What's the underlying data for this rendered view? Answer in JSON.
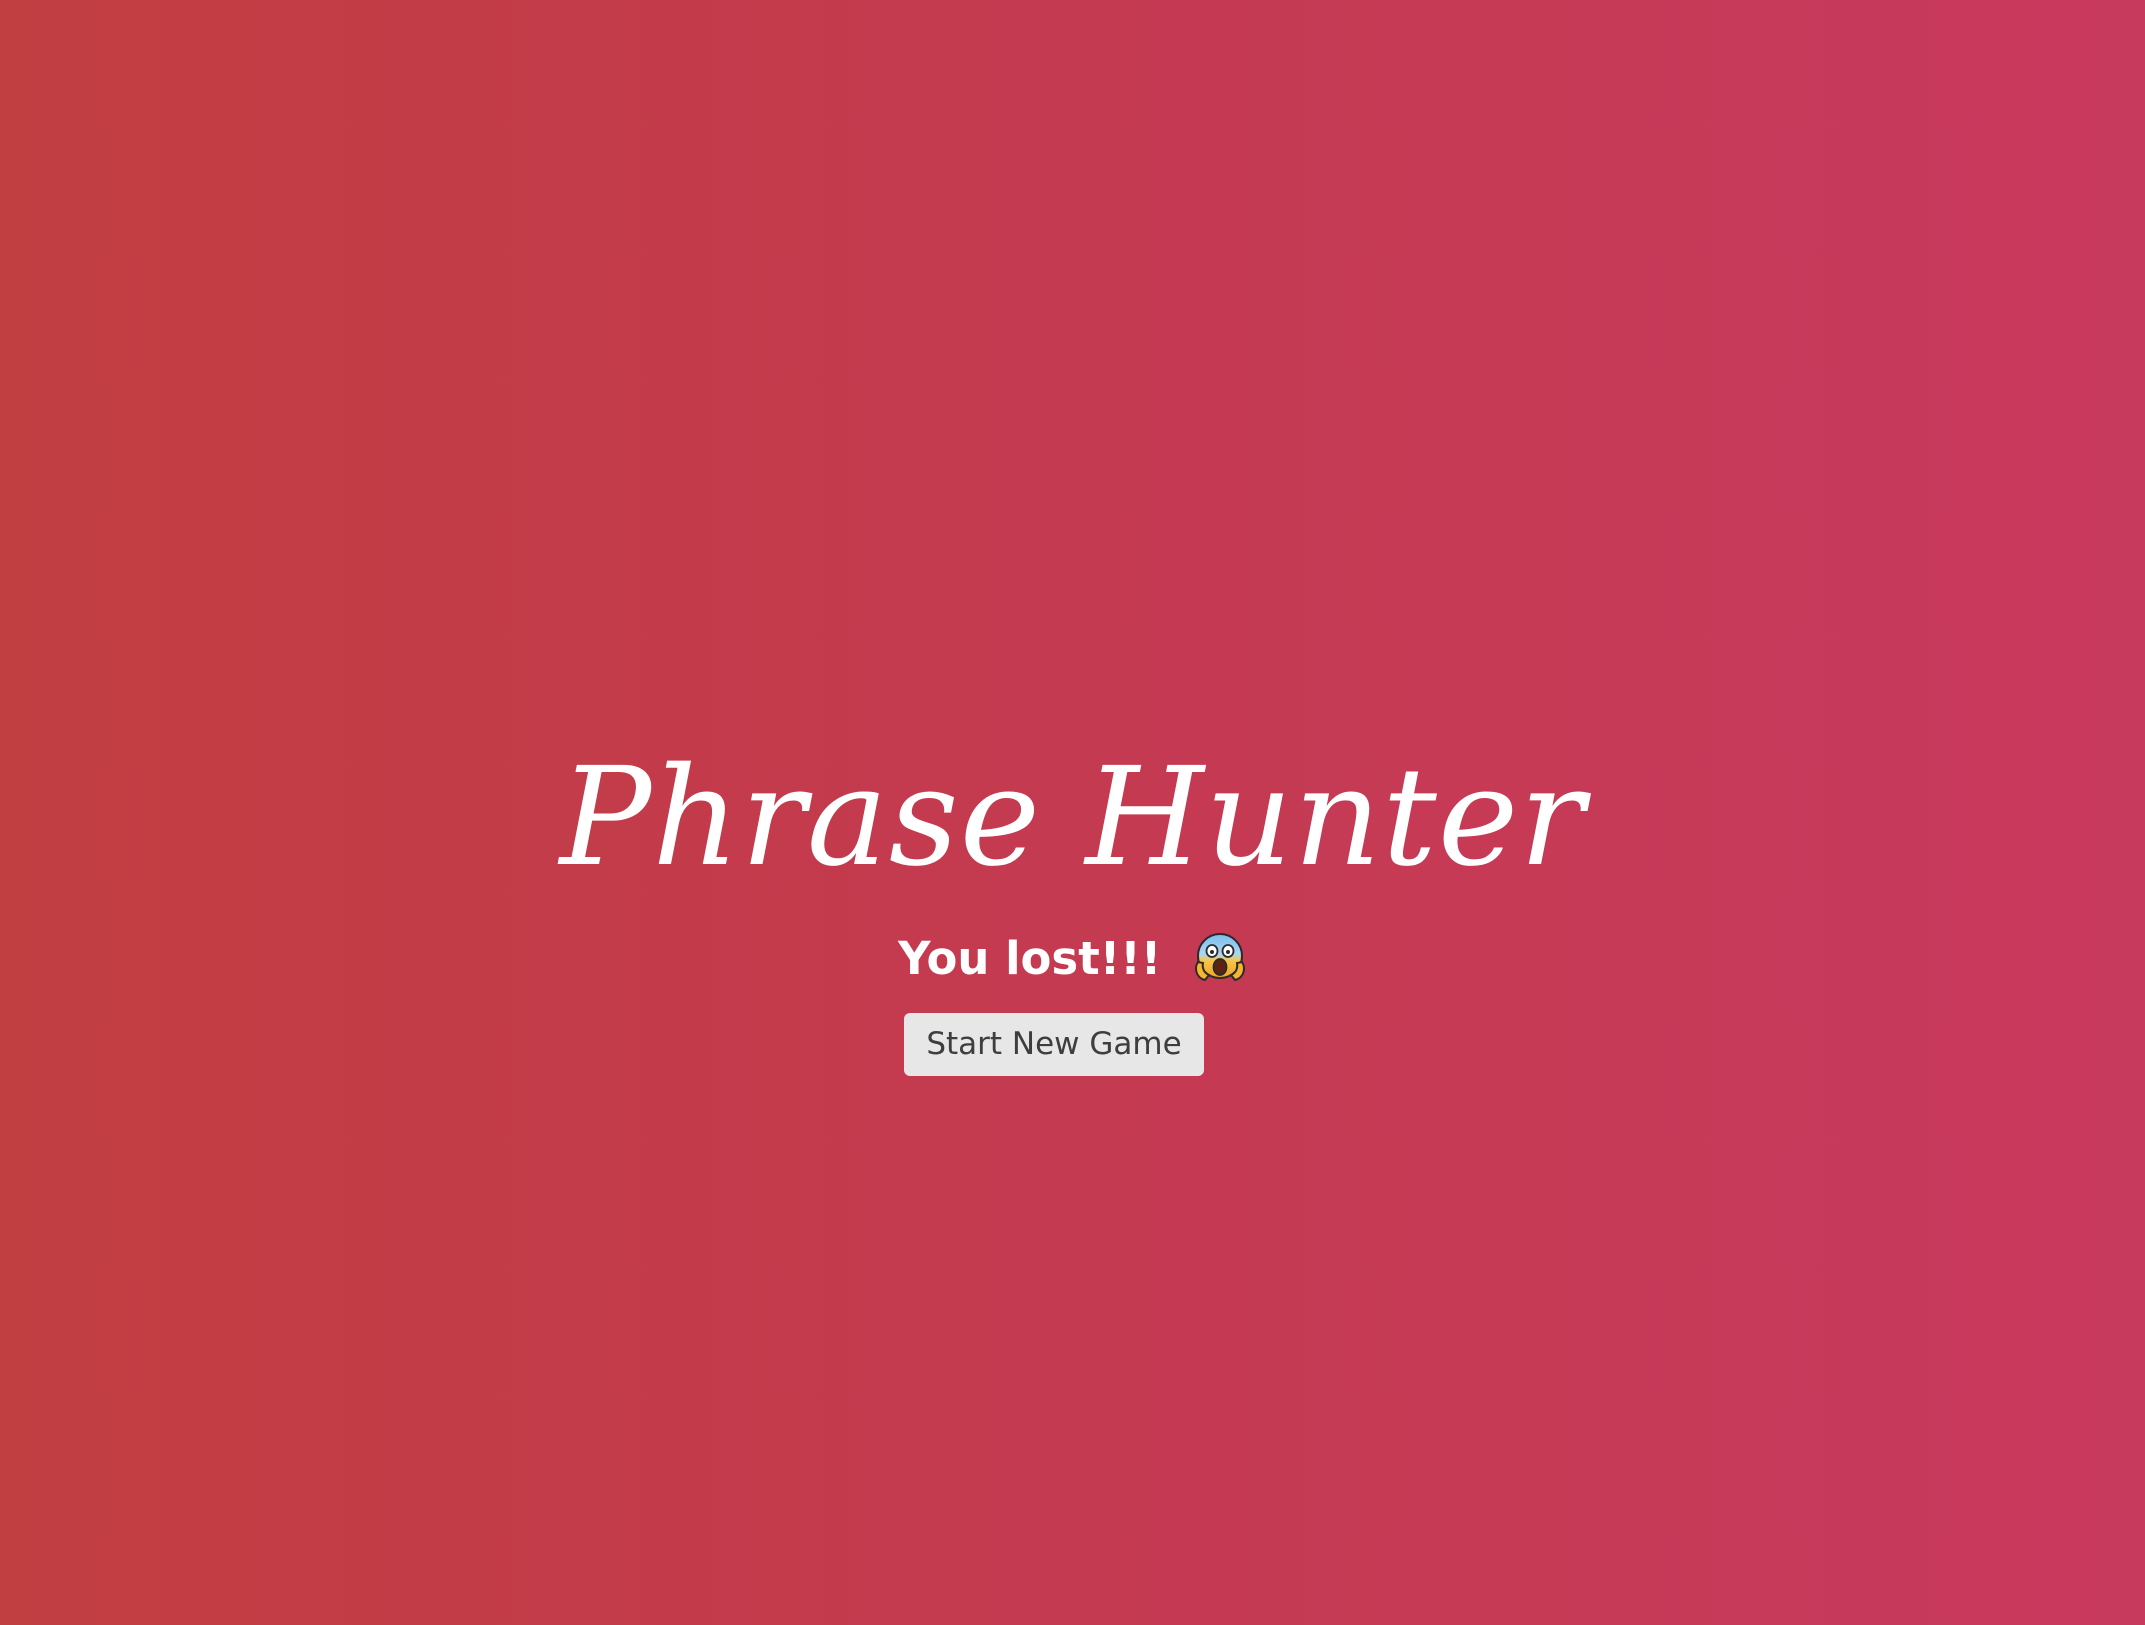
{
  "game": {
    "title": "Phrase Hunter",
    "status_text": "You lost!!!",
    "status_icon": "scared-face-icon",
    "start_button_label": "Start New Game"
  },
  "colors": {
    "background_left": "#c13e41",
    "background_right": "#c8395e",
    "text": "#ffffff",
    "button_background": "#e7e7e7",
    "button_text": "#3e3e3e"
  }
}
